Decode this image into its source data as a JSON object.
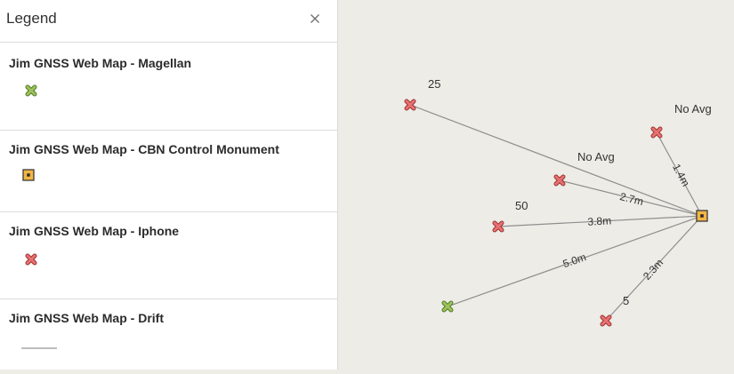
{
  "legend": {
    "title": "Legend",
    "close_icon": "close-icon",
    "layers": [
      {
        "name": "Jim GNSS Web Map - Magellan",
        "symbol": "x-marker",
        "color": "#8fb34a"
      },
      {
        "name": "Jim GNSS Web Map - CBN Control Monument",
        "symbol": "square-marker",
        "color": "#f2b544"
      },
      {
        "name": "Jim GNSS Web Map - Iphone",
        "symbol": "x-marker",
        "color": "#e26060"
      },
      {
        "name": "Jim GNSS Web Map - Drift",
        "symbol": "line",
        "color": "#a8a8a8"
      }
    ]
  },
  "map": {
    "background": "#edece6",
    "point_labels": [
      "25",
      "No Avg",
      "No Avg",
      "50",
      "5"
    ],
    "distance_labels": [
      "1.4m",
      "2.7m",
      "3.8m",
      "5.0m",
      "2.3m"
    ]
  }
}
